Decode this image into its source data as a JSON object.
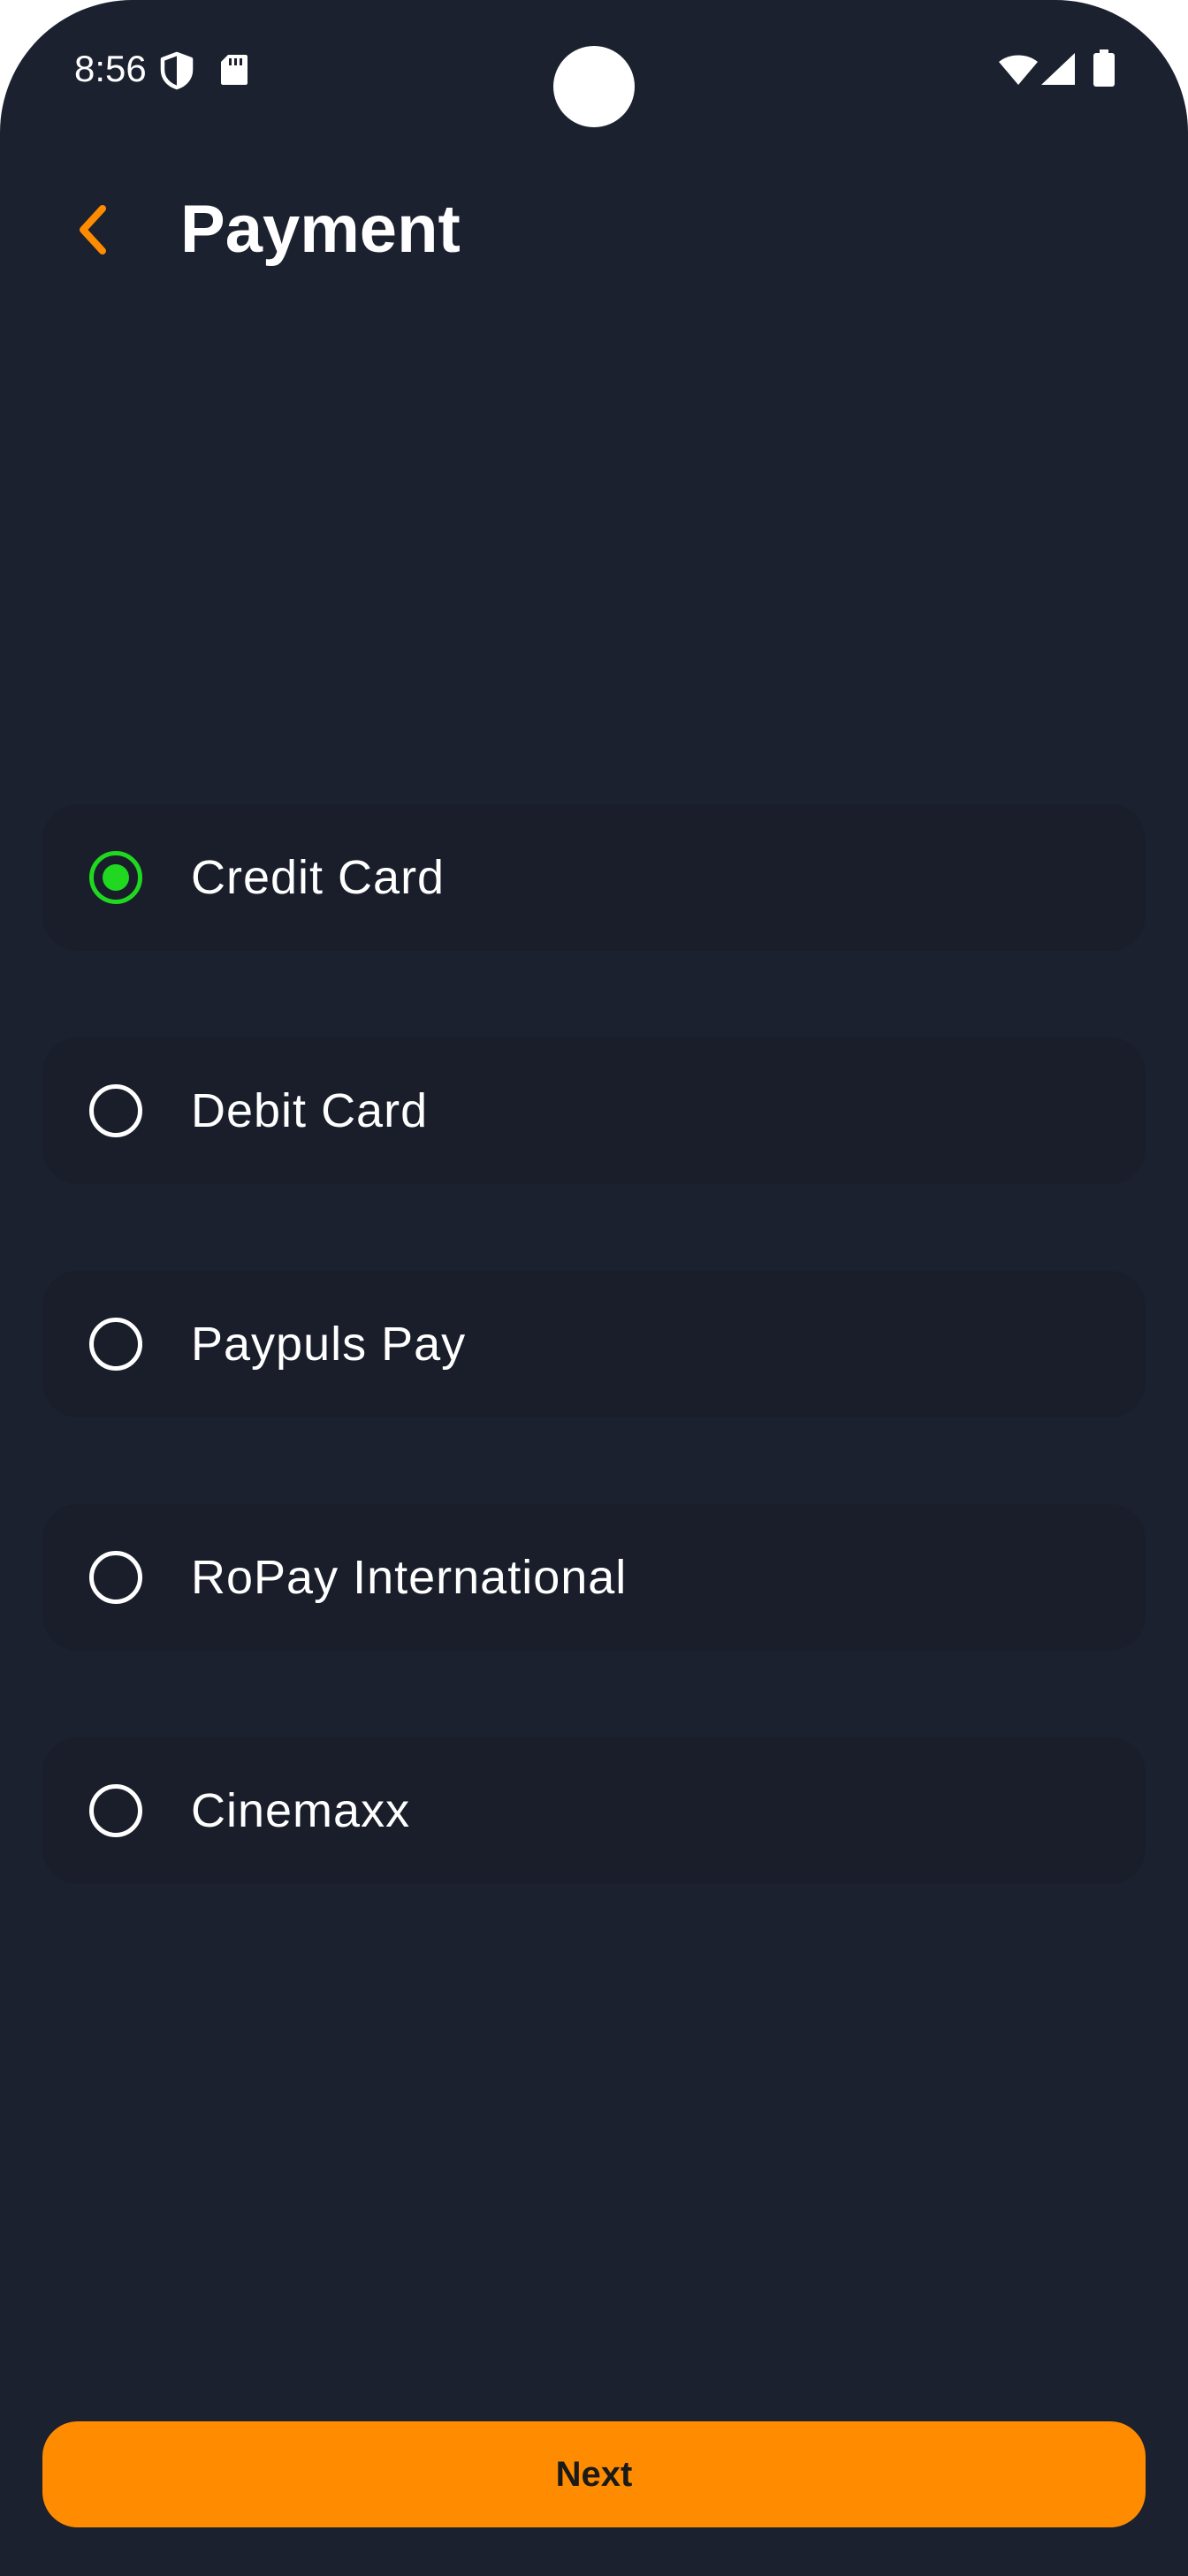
{
  "status_bar": {
    "time": "8:56",
    "icons": [
      "shield-icon",
      "sd-card-icon",
      "wifi-icon",
      "signal-icon",
      "battery-icon"
    ]
  },
  "header": {
    "title": "Payment",
    "back_icon": "chevron-left-icon"
  },
  "payment_options": [
    {
      "label": "Credit Card",
      "selected": true
    },
    {
      "label": "Debit Card",
      "selected": false
    },
    {
      "label": "Paypuls Pay",
      "selected": false
    },
    {
      "label": "RoPay International",
      "selected": false
    },
    {
      "label": "Cinemaxx",
      "selected": false
    }
  ],
  "footer": {
    "next_label": "Next"
  },
  "colors": {
    "background": "#1c2130",
    "card": "#191e2a",
    "accent": "#ff8c00",
    "selected": "#1fd81f",
    "text": "#ffffff"
  }
}
